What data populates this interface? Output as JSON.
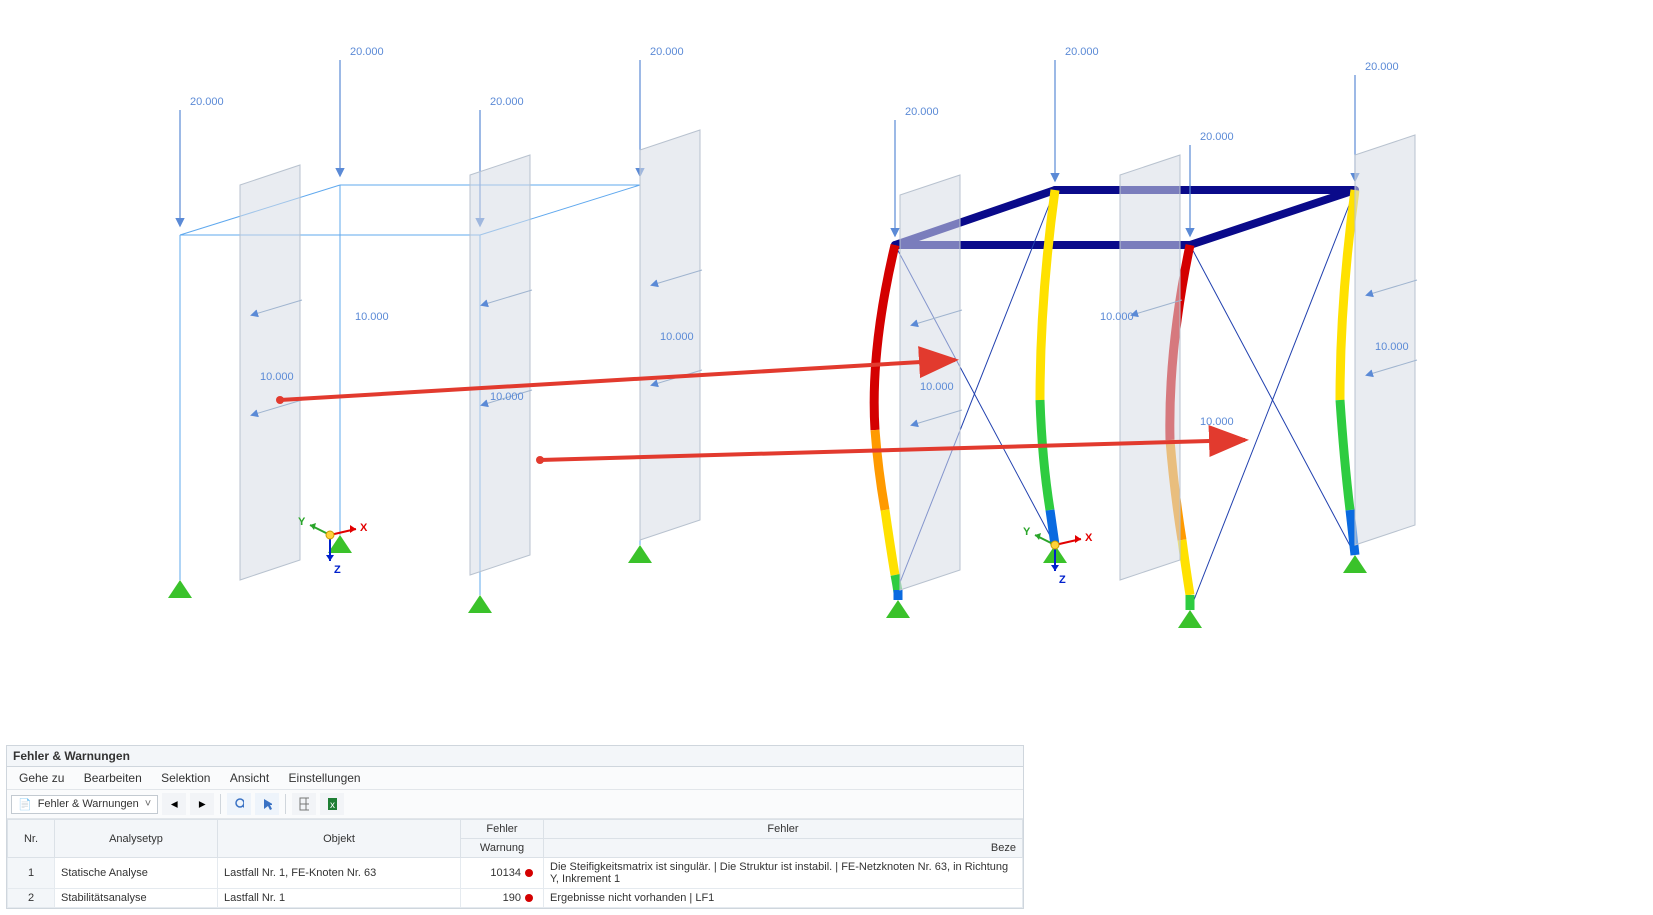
{
  "load_value_top": "20.000",
  "load_value_side": "10.000",
  "axis_x": "X",
  "axis_y": "Y",
  "axis_z": "Z",
  "panel": {
    "title": "Fehler & Warnungen",
    "menu": {
      "goto": "Gehe zu",
      "edit": "Bearbeiten",
      "selection": "Selektion",
      "view": "Ansicht",
      "settings": "Einstellungen"
    },
    "combo_label": "Fehler & Warnungen",
    "columns": {
      "nr": "Nr.",
      "analysis_type": "Analysetyp",
      "object": "Objekt",
      "error_warning_top": "Fehler",
      "error_warning_bottom": "Warnung",
      "error_top": "Fehler",
      "error_bottom": "Beze"
    },
    "rows": [
      {
        "nr": "1",
        "analysis_type": "Statische Analyse",
        "object": "Lastfall Nr. 1, FE-Knoten Nr. 63",
        "code": "10134",
        "message": "Die Steifigkeitsmatrix ist singulär. |  Die Struktur ist instabil. | FE-Netzknoten Nr. 63, in Richtung Y, Inkrement 1"
      },
      {
        "nr": "2",
        "analysis_type": "Stabilitätsanalyse",
        "object": "Lastfall Nr. 1",
        "code": "190",
        "message": "Ergebnisse nicht vorhanden | LF1"
      }
    ]
  }
}
